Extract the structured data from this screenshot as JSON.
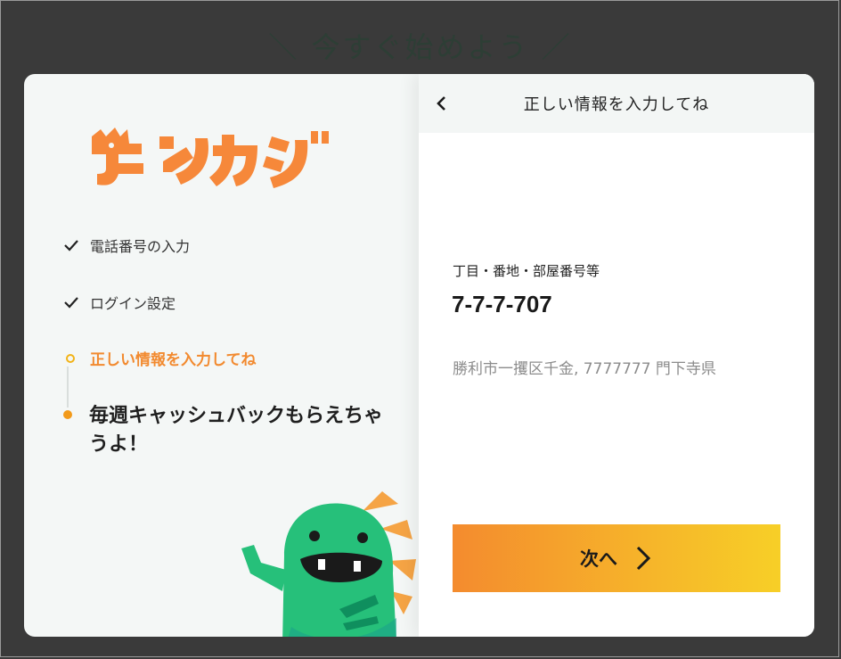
{
  "headline": "＼ 今すぐ始めよう ／",
  "brand": {
    "logo_text": "モンカシ",
    "color": "#f6883a"
  },
  "steps": [
    {
      "label": "電話番号の入力",
      "state": "done"
    },
    {
      "label": "ログイン設定",
      "state": "done"
    },
    {
      "label": "正しい情報を入力してね",
      "state": "active"
    }
  ],
  "promo": "毎週キャッシュバックもらえちゃうよ！",
  "panel": {
    "title": "正しい情報を入力してね",
    "back_icon": "chevron-left-icon",
    "field_label": "丁目・番地・部屋番号等",
    "field_value": "7-7-7-707",
    "address": "勝利市一攫区千金, 7777777 門下寺県",
    "next_label": "次へ"
  },
  "colors": {
    "accent": "#f28a2f",
    "button_gradient": [
      "#f48b2e",
      "#f7cf27"
    ],
    "mascot": "#26c07a"
  }
}
